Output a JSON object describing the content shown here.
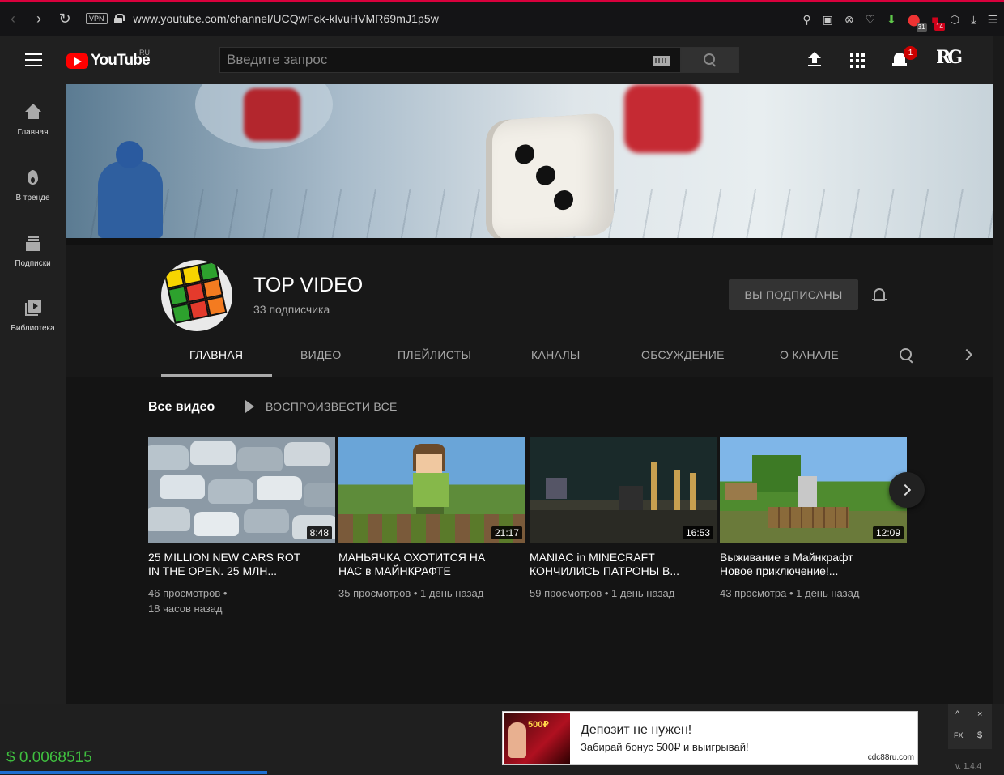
{
  "browser": {
    "url": "www.youtube.com/channel/UCQwFck-klvuHVMR69mJ1p5w",
    "vpn_label": "VPN",
    "ext_abp_count": "31",
    "ext_red_count": "14"
  },
  "header": {
    "logo_text": "YouTube",
    "region": "RU",
    "search_placeholder": "Введите запрос",
    "notifications_count": "1",
    "avatar_text": "RG"
  },
  "sidebar": {
    "items": [
      {
        "label": "Главная",
        "icon": "home-icon"
      },
      {
        "label": "В тренде",
        "icon": "trending-icon"
      },
      {
        "label": "Подписки",
        "icon": "subscriptions-icon"
      },
      {
        "label": "Библиотека",
        "icon": "library-icon"
      }
    ]
  },
  "channel": {
    "title": "TOP VIDEO",
    "subscribers": "33 подписчика",
    "subscribe_button": "ВЫ ПОДПИСАНЫ",
    "tabs": [
      "ГЛАВНАЯ",
      "ВИДЕО",
      "ПЛЕЙЛИСТЫ",
      "КАНАЛЫ",
      "ОБСУЖДЕНИЕ",
      "О КАНАЛЕ"
    ],
    "active_tab": "ГЛАВНАЯ"
  },
  "section": {
    "title": "Все видео",
    "play_all": "ВОСПРОИЗВЕСТИ ВСЕ"
  },
  "videos": [
    {
      "title_line1": "25 MILLION NEW CARS ROT",
      "title_line2": "IN THE OPEN. 25 МЛН...",
      "duration": "8:48",
      "meta_line1": "46 просмотров •",
      "meta_line2": "18 часов назад"
    },
    {
      "title_line1": "МАНЬЯЧКА ОХОТИТСЯ НА",
      "title_line2": "НАС в МАЙНКРАФТЕ",
      "duration": "21:17",
      "meta_line1": "35 просмотров • 1 день назад",
      "meta_line2": ""
    },
    {
      "title_line1": "MANIAC in MINECRAFT",
      "title_line2": "КОНЧИЛИСЬ ПАТРОНЫ В...",
      "duration": "16:53",
      "meta_line1": "59 просмотров • 1 день назад",
      "meta_line2": ""
    },
    {
      "title_line1": "Выживание в Майнкрафт",
      "title_line2": "Новое приключение!...",
      "duration": "12:09",
      "meta_line1": "43 просмотра • 1 день назад",
      "meta_line2": ""
    }
  ],
  "bottom": {
    "crypto_value": "$ 0.0068515",
    "ad_title": "Депозит не нужен!",
    "ad_text": "Забирай бонус 500₽ и выигрывай!",
    "ad_domain": "cdc88ru.com",
    "ad_image_label": "500₽",
    "fx_label": "FX",
    "dollar_label": "$",
    "up_label": "^",
    "close_label": "×",
    "version": "v. 1.4.4"
  },
  "colors": {
    "accent_red": "#ff0000",
    "crypto_green": "#3fbf3f",
    "browser_red": "#d8003c"
  }
}
